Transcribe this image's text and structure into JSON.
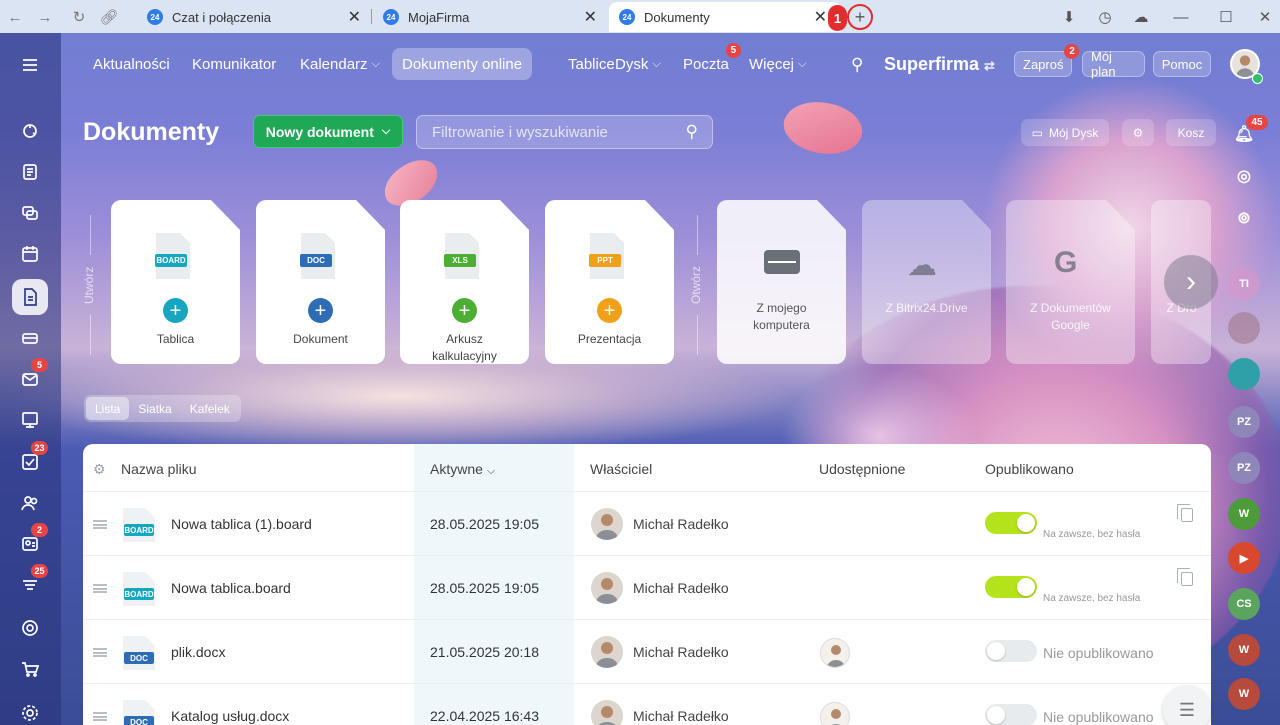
{
  "browser": {
    "tabs": [
      {
        "title": "Czat i połączenia",
        "favicon": "24"
      },
      {
        "title": "MojaFirma",
        "favicon": "24"
      },
      {
        "title": "Dokumenty",
        "favicon": "24"
      }
    ],
    "tab_count_badge": "1",
    "new_tab": "+"
  },
  "topnav": {
    "items": [
      {
        "label": "Aktualności"
      },
      {
        "label": "Komunikator"
      },
      {
        "label": "Kalendarz"
      },
      {
        "label": "Dokumenty online"
      },
      {
        "label": "Tablice"
      },
      {
        "label": "Dysk"
      },
      {
        "label": "Poczta",
        "badge": "5"
      },
      {
        "label": "Więcej"
      }
    ],
    "brand": "Superfirma",
    "invite": "Zaproś",
    "invite_badge": "2",
    "my_plan": "Mój plan",
    "help": "Pomoc"
  },
  "sidebar": {
    "badges": {
      "mail": "5",
      "tasks": "23",
      "contacts": "2",
      "feed": "25"
    }
  },
  "rightbar": {
    "notif_badge": "45",
    "avatars": [
      "TI",
      "PZ",
      "PZ",
      "W",
      "CS",
      "W",
      "W"
    ]
  },
  "header": {
    "title": "Dokumenty",
    "new_doc": "Nowy dokument",
    "search_placeholder": "Filtrowanie i wyszukiwanie",
    "my_drive": "Mój Dysk",
    "trash": "Kosz"
  },
  "create": {
    "label": "Utwórz",
    "cards": [
      {
        "tag": "BOARD",
        "label": "Tablica",
        "color": "#17a6bf"
      },
      {
        "tag": "DOC",
        "label": "Dokument",
        "color": "#2e6db4"
      },
      {
        "tag": "XLS",
        "label": "Arkusz kalkulacyjny",
        "color": "#4cae34"
      },
      {
        "tag": "PPT",
        "label": "Prezentacja",
        "color": "#f0a019"
      }
    ]
  },
  "open": {
    "label": "Otwórz",
    "cards": [
      {
        "label": "Z mojego komputera"
      },
      {
        "label": "Z Bitrix24.Drive"
      },
      {
        "label": "Z Dokumentów Google"
      },
      {
        "label": "Z Dro"
      }
    ]
  },
  "views": [
    "Lista",
    "Siatka",
    "Kafelek"
  ],
  "table": {
    "headers": {
      "name": "Nazwa pliku",
      "active": "Aktywne",
      "owner": "Właściciel",
      "shared": "Udostępnione",
      "published": "Opublikowano"
    },
    "rows": [
      {
        "tag": "BOARD",
        "tagColor": "#17a6bf",
        "name": "Nowa tablica (1).board",
        "date": "28.05.2025 19:05",
        "owner": "Michał Radełko",
        "shared": false,
        "published": true,
        "pub_text": "Na zawsze, bez hasła"
      },
      {
        "tag": "BOARD",
        "tagColor": "#17a6bf",
        "name": "Nowa tablica.board",
        "date": "28.05.2025 19:05",
        "owner": "Michał Radełko",
        "shared": false,
        "published": true,
        "pub_text": "Na zawsze, bez hasła"
      },
      {
        "tag": "DOC",
        "tagColor": "#2e6db4",
        "name": "plik.docx",
        "date": "21.05.2025 20:18",
        "owner": "Michał Radełko",
        "shared": true,
        "published": false,
        "pub_text": "Nie opublikowano"
      },
      {
        "tag": "DOC",
        "tagColor": "#2e6db4",
        "name": "Katalog usług.docx",
        "date": "22.04.2025 16:43",
        "owner": "Michał Radełko",
        "shared": true,
        "published": false,
        "pub_text": "Nie opublikowano"
      }
    ]
  }
}
